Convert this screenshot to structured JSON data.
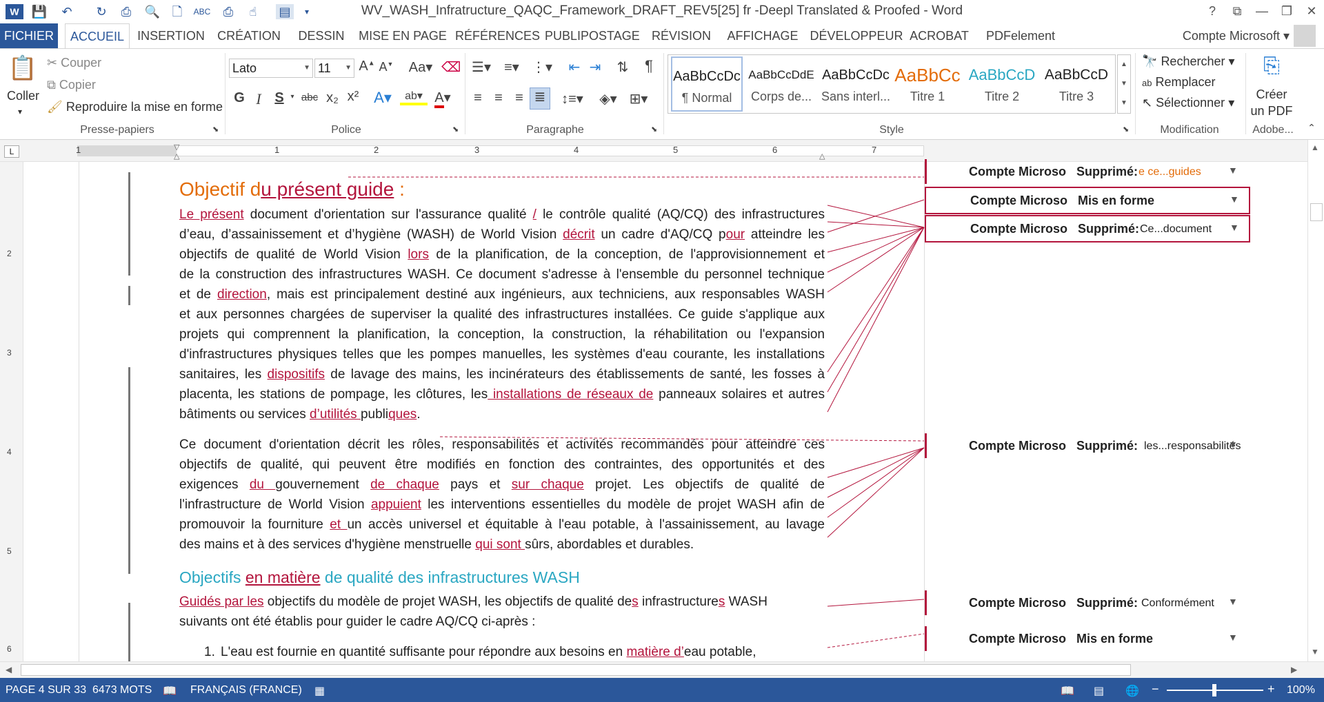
{
  "window": {
    "title": "WV_WASH_Infratructure_QAQC_Framework_DRAFT_REV5[25] fr -Deepl Translated & Proofed - Word",
    "controls": [
      "?",
      "⧉",
      "—",
      "❐",
      "✕"
    ]
  },
  "tabs": [
    "FICHIER",
    "ACCUEIL",
    "INSERTION",
    "CRÉATION",
    "DESSIN",
    "MISE EN PAGE",
    "RÉFÉRENCES",
    "PUBLIPOSTAGE",
    "RÉVISION",
    "AFFICHAGE",
    "DÉVELOPPEUR",
    "ACROBAT",
    "PDFelement"
  ],
  "account": "Compte Microsoft",
  "ribbon": {
    "clipboard": {
      "paste": "Coller",
      "cut": "Couper",
      "copy": "Copier",
      "format_painter": "Reproduire la mise en forme",
      "label": "Presse-papiers"
    },
    "font": {
      "name": "Lato",
      "size": "11",
      "label": "Police",
      "case": "Aa",
      "bold": "G",
      "italic": "I",
      "underline": "S",
      "strike": "abc",
      "sub": "x₂",
      "sup": "x²"
    },
    "paragraph": {
      "label": "Paragraphe"
    },
    "styles": {
      "label": "Style",
      "items": [
        {
          "preview": "AaBbCcDc",
          "name": "¶ Normal",
          "color": "#222222"
        },
        {
          "preview": "AaBbCcDdE",
          "name": "Corps de...",
          "color": "#222222"
        },
        {
          "preview": "AaBbCcDc",
          "name": "Sans interl...",
          "color": "#222222"
        },
        {
          "preview": "AaBbCc",
          "name": "Titre 1",
          "color": "#e36c09"
        },
        {
          "preview": "AaBbCcD",
          "name": "Titre 2",
          "color": "#2aa7c2"
        },
        {
          "preview": "AaBbCcD",
          "name": "Titre 3",
          "color": "#222222"
        }
      ]
    },
    "editing": {
      "find": "Rechercher",
      "replace": "Remplacer",
      "select": "Sélectionner",
      "label": "Modification"
    },
    "adobe": {
      "create_pdf_1": "Créer",
      "create_pdf_2": "un PDF",
      "label": "Adobe..."
    }
  },
  "ruler_numbers": [
    "1",
    "1",
    "2",
    "3",
    "4",
    "5",
    "6",
    "7"
  ],
  "vruler_numbers": [
    "2",
    "3",
    "4",
    "5",
    "6"
  ],
  "document": {
    "heading1_pre": "Objectif d",
    "heading1_ins": "u présent guide",
    "heading1_post": " :",
    "p1": [
      {
        "ins": "Le présent",
        "rest": " document d'orientation sur l'assurance qualité ",
        "ins2": "/",
        "rest2": " le contrôle qualité (AQ/CQ) des infrastructures"
      },
      {
        "text": "d’eau, d’assainissement et d’hygiène (WASH) de World Vision ",
        "ins": "décrit",
        "rest": " un cadre d'AQ/CQ p",
        "ins2": "our",
        "rest2": " atteindre les"
      },
      {
        "text": "objectifs de qualité de World Vision ",
        "ins": "lors",
        "rest": " de la planification, de la conception, de l'approvisionnement et"
      },
      {
        "text": "de la construction des infrastructures WASH. Ce document s'adresse à l'ensemble du personnel technique"
      },
      {
        "text": "et de ",
        "ins": "direction",
        "rest": ", mais est principalement destiné aux ingénieurs, aux techniciens, aux responsables WASH"
      },
      {
        "text": "et aux personnes chargées de superviser la qualité des infrastructures installées. Ce guide s'applique aux"
      },
      {
        "text": "projets qui comprennent la planification, la conception, la construction, la réhabilitation ou l'expansion"
      },
      {
        "text": "d'infrastructures physiques telles que les pompes manuelles, les systèmes d'eau courante, les installations"
      },
      {
        "text": "sanitaires, les ",
        "ins": "dispositifs",
        "rest": " de lavage des mains, les incinérateurs des établissements de santé, les fosses à"
      },
      {
        "text": "placenta, les stations de pompage, les clôtures, les",
        "ins": " installations de réseaux de",
        "rest": " panneaux solaires et autres"
      },
      {
        "text": "bâtiments ou services ",
        "ins": "d’utilités ",
        "rest": "publi",
        "ins2": "ques",
        "rest2": "."
      }
    ],
    "p2": [
      {
        "text": "Ce document d'orientation décrit les rôles, responsabilités et activités recommandés pour atteindre ces"
      },
      {
        "text": "objectifs de qualité, qui peuvent être modifiés en fonction des contraintes, des opportunités et des"
      },
      {
        "text": "exigences ",
        "ins": "du ",
        "rest": "gouvernement ",
        "ins2": "de chaque",
        "rest2": " pays et ",
        "ins3": "sur chaque",
        "rest3": " projet. Les objectifs de qualité de"
      },
      {
        "text": "l'infrastructure de World Vision ",
        "ins": "appuient",
        "rest": " les interventions essentielles du modèle de projet WASH afin de"
      },
      {
        "text": "promouvoir la fourniture ",
        "ins": "et ",
        "rest": "un accès universel et équitable à l'eau potable, à l'assainissement, au lavage"
      },
      {
        "text": "des mains et à des services d'hygiène menstruelle ",
        "ins": "qui sont ",
        "rest": "sûrs, abordables et durables."
      }
    ],
    "heading2_pre": "Objectifs ",
    "heading2_ins": "en matière",
    "heading2_post": " de qualité des infrastructures WASH",
    "p3": [
      {
        "ins": "Guidés par les",
        "rest": " objectifs du modèle de projet WASH, les objectifs de qualité de",
        "ins2": "s",
        "rest2": " infrastructure",
        "ins3": "s",
        "rest3": " WASH"
      },
      {
        "text": "suivants ont été établis pour guider le cadre AQ/CQ ci-après :"
      }
    ],
    "list_item_1_num": "1.",
    "list_item_1_pre": "L'eau est fournie en quantité suffisante pour répondre aux besoins en ",
    "list_item_1_ins": "matière d’",
    "list_item_1_post": "eau potable,"
  },
  "markup": [
    {
      "author": "Compte Microso",
      "kind": "Supprimé:",
      "text": "e ce...guides",
      "orange": true
    },
    {
      "author": "Compte Microso",
      "kind": "Mis en forme",
      "text": ""
    },
    {
      "author": "Compte Microso",
      "kind": "Supprimé:",
      "text": "Ce...document"
    },
    {
      "author": "Compte Microso",
      "kind": "Supprimé:",
      "text": "les...responsabilités"
    },
    {
      "author": "Compte Microso",
      "kind": "Supprimé:",
      "text": "Conformément"
    },
    {
      "author": "Compte Microso",
      "kind": "Mis en forme",
      "text": ""
    }
  ],
  "status": {
    "page": "PAGE 4 SUR 33",
    "words": "6473 MOTS",
    "language": "FRANÇAIS (FRANCE)",
    "zoom": "100%"
  }
}
